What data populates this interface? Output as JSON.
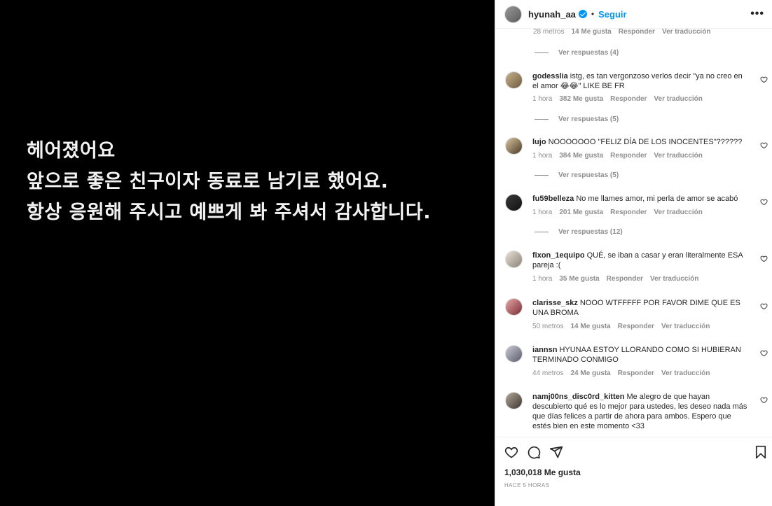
{
  "post": {
    "lines": [
      "헤어졌어요",
      "앞으로 좋은 친구이자 동료로 남기로 했어요.",
      "항상 응원해 주시고 예쁘게 봐 주셔서 감사합니다."
    ]
  },
  "header": {
    "username": "hyunah_aa",
    "separator": "•",
    "follow_label": "Seguir",
    "more_label": "•••"
  },
  "top_partial": {
    "time": "28 metros",
    "likes": "14 Me gusta",
    "reply": "Responder",
    "translate": "Ver traducción"
  },
  "comments": [
    {
      "user": "godesslia",
      "text": "istg, es tan vergonzoso verlos decir \"ya no creo en el amor 😂😂\" LIKE BE FR",
      "time": "1 hora",
      "likes": "382 Me gusta",
      "reply": "Responder",
      "translate": "Ver traducción",
      "replies": "Ver respuestas (5)"
    },
    {
      "user": "lujo",
      "text": "NOOOOOOO \"FELIZ DÍA DE LOS INOCENTES\"??????",
      "time": "1 hora",
      "likes": "384 Me gusta",
      "reply": "Responder",
      "translate": "Ver traducción",
      "replies": "Ver respuestas (5)"
    },
    {
      "user": "fu59belleza",
      "text": "No me llames amor, mi perla de amor se acabó",
      "time": "1 hora",
      "likes": "201 Me gusta",
      "reply": "Responder",
      "translate": "Ver traducción",
      "replies": "Ver respuestas (12)"
    },
    {
      "user": "fixon_1equipo",
      "text": "QUÉ, se iban a casar y eran literalmente ESA pareja :(",
      "time": "1 hora",
      "likes": "35 Me gusta",
      "reply": "Responder",
      "translate": "Ver traducción"
    },
    {
      "user": "clarisse_skz",
      "text": "NOOO WTFFFFF POR FAVOR DIME QUE ES UNA BROMA",
      "time": "50 metros",
      "likes": "14 Me gusta",
      "reply": "Responder",
      "translate": "Ver traducción"
    },
    {
      "user": "iannsn",
      "text": "HYUNAA ESTOY LLORANDO COMO SI HUBIERAN TERMINADO CONMIGO",
      "time": "44 metros",
      "likes": "24 Me gusta",
      "reply": "Responder",
      "translate": "Ver traducción"
    },
    {
      "user": "namj00ns_disc0rd_kitten",
      "text": "Me alegro de que hayan descubierto qué es lo mejor para ustedes, les deseo nada más que días felices a partir de ahora para ambos. Espero que estés bien en este momento <33"
    }
  ],
  "first_replies": "Ver respuestas (4)",
  "footer": {
    "likes": "1,030,018 Me gusta",
    "time": "HACE 5 HORAS"
  },
  "icons": [
    "heart-icon",
    "comment-icon",
    "share-icon",
    "bookmark-icon",
    "verified-icon",
    "more-icon"
  ],
  "colors": {
    "link": "#0095f6",
    "muted": "#8e8e8e",
    "text": "#262626",
    "post_bg": "#000000"
  }
}
